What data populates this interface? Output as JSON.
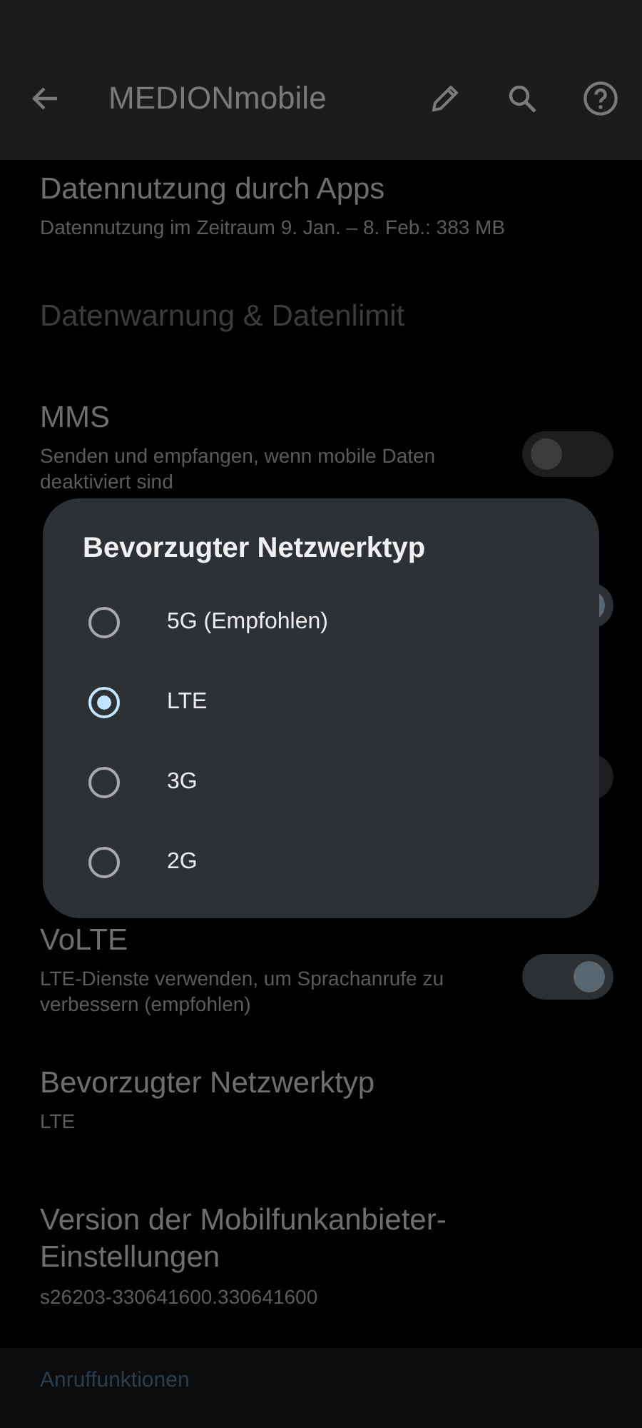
{
  "app_bar": {
    "title": "MEDIONmobile"
  },
  "settings": [
    {
      "kind": "summary",
      "title": "Datennutzung durch Apps",
      "summary": "Datennutzung im Zeitraum 9. Jan. – 8. Feb.: 383 MB",
      "disabled": false
    },
    {
      "kind": "summary",
      "title": "Datenwarnung & Datenlimit",
      "disabled": true
    },
    {
      "kind": "toggle",
      "title": "MMS",
      "summary": "Senden und empfangen, wenn mobile Daten deaktiviert sind",
      "on": false
    },
    {
      "kind": "toggle",
      "on": true
    },
    {
      "kind": "toggle",
      "on": false
    },
    {
      "kind": "toggle",
      "title": "VoLTE",
      "summary": "LTE-Dienste verwenden, um Sprachanrufe zu verbessern (empfohlen)",
      "on": true
    },
    {
      "kind": "summary",
      "title": "Bevorzugter Netzwerktyp",
      "summary": "LTE",
      "disabled": false
    },
    {
      "kind": "summary",
      "title": "Version der Mobilfunkanbieter-Einstellungen",
      "summary": "s26203-330641600.330641600",
      "disabled": false
    }
  ],
  "section_header": "Anruffunktionen",
  "dialog": {
    "title": "Bevorzugter Netzwerktyp",
    "options": [
      {
        "label": "5G (Empfohlen)",
        "selected": false
      },
      {
        "label": "LTE",
        "selected": true
      },
      {
        "label": "3G",
        "selected": false
      },
      {
        "label": "2G",
        "selected": false
      }
    ]
  }
}
